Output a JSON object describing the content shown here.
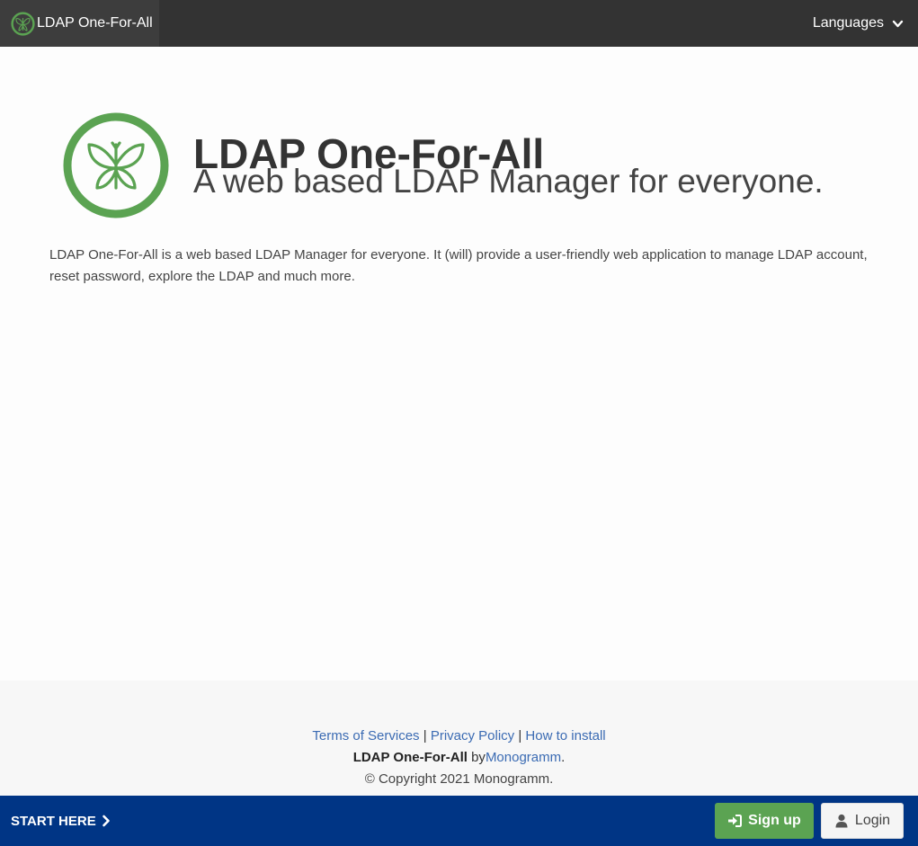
{
  "navbar": {
    "brand_label": "LDAP One-For-All",
    "brand_icon": "butterfly-logo-icon",
    "languages_label": "Languages",
    "languages_icon": "chevron-down-icon"
  },
  "hero": {
    "logo_icon": "butterfly-logo-icon",
    "title": "LDAP One-For-All",
    "subtitle": "A web based LDAP Manager for everyone.",
    "description": "LDAP One-For-All is a web based LDAP Manager for everyone. It (will) provide a user-friendly web application to manage LDAP account, reset password, explore the LDAP and much more."
  },
  "footer": {
    "links": [
      "Terms of Services",
      "Privacy Policy",
      "How to install"
    ],
    "separator": "|",
    "credit_name": "LDAP One-For-All",
    "credit_by": "by",
    "credit_author": "Monogramm",
    "credit_end": ".",
    "copyright": "© Copyright 2021 Monogramm."
  },
  "bottombar": {
    "start_label": "START HERE",
    "start_icon": "chevron-right-icon",
    "signup_label": "Sign up",
    "signup_icon": "sign-in-icon",
    "login_label": "Login",
    "login_icon": "user-icon"
  },
  "colors": {
    "navbar": "#333333",
    "brand_green": "#5ba352",
    "bottombar": "#003585",
    "link": "#3b6bb3"
  }
}
